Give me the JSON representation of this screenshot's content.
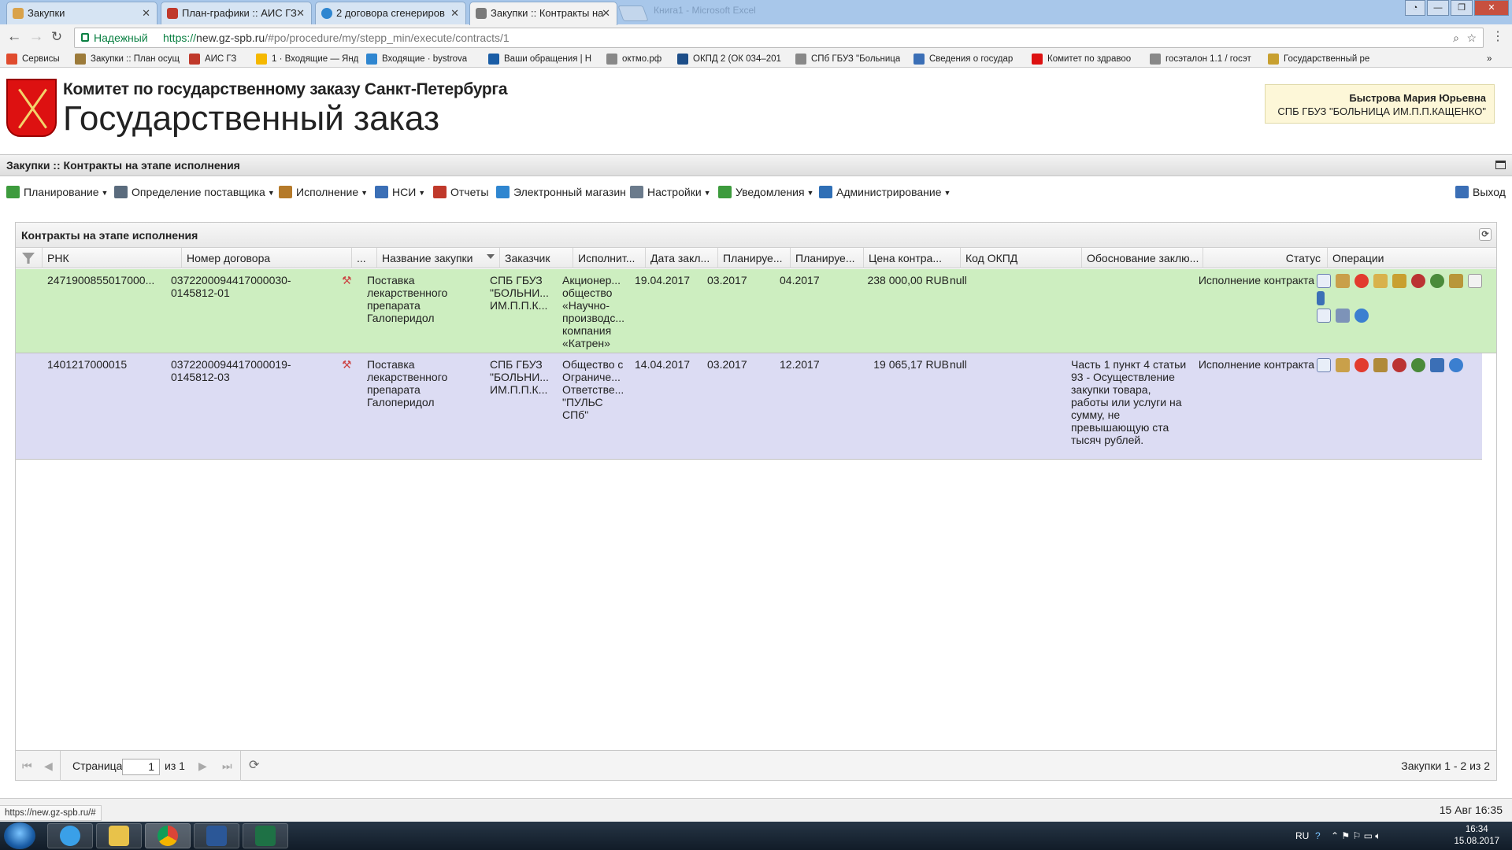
{
  "browser": {
    "tabs": [
      {
        "title": "Закупки",
        "color": "#d9a24a"
      },
      {
        "title": "План-графики :: АИС ГЗ",
        "color": "#c0392b"
      },
      {
        "title": "2 договора сгенериров",
        "color": "#2f86d0"
      },
      {
        "title": "Закупки :: Контракты на",
        "color": "#7a7a7a"
      }
    ],
    "faded_title": "Книга1 - Microsoft Excel",
    "address": {
      "secure_label": "Надежный",
      "protocol": "https://",
      "host": "new.gz-spb.ru",
      "path": "/#po/procedure/my/stepp_min/execute/contracts/1"
    },
    "bookmarks": [
      {
        "label": "Сервисы",
        "color": "#e04b2e"
      },
      {
        "label": "Закупки :: План осущ",
        "color": "#9c7b3a"
      },
      {
        "label": "АИС ГЗ",
        "color": "#c0392b"
      },
      {
        "label": "1 · Входящие — Янд",
        "color": "#f5b800"
      },
      {
        "label": "Входящие · bystrova",
        "color": "#2f86d0"
      },
      {
        "label": "Ваши обращения | Н",
        "color": "#1a5da6"
      },
      {
        "label": "октмо.рф",
        "color": "#888888"
      },
      {
        "label": "ОКПД 2 (ОК 034–201",
        "color": "#1d4e89"
      },
      {
        "label": "СПб ГБУЗ \"Больница",
        "color": "#888888"
      },
      {
        "label": "Сведения о государ",
        "color": "#3b6fb6"
      },
      {
        "label": "Комитет по здравоо",
        "color": "#d11"
      },
      {
        "label": "госэталон 1.1 / госэт",
        "color": "#888888"
      },
      {
        "label": "Государственный ре",
        "color": "#c8a030"
      }
    ],
    "bookmarks_more": "»"
  },
  "header": {
    "org": "Комитет по государственному заказу Санкт-Петербурга",
    "app": "Государственный заказ",
    "user_name": "Быстрова Мария Юрьевна",
    "user_org": "СПБ ГБУЗ \"БОЛЬНИЦА ИМ.П.П.КАЩЕНКО\""
  },
  "title": "Закупки :: Контракты на этапе исполнения",
  "menu": {
    "items": [
      {
        "label": "Планирование",
        "icon": "planning-icon",
        "dropdown": true,
        "color": "#3d9b3d"
      },
      {
        "label": "Определение поставщика",
        "icon": "gears-icon",
        "dropdown": true,
        "color": "#5a6b7d"
      },
      {
        "label": "Исполнение",
        "icon": "execution-icon",
        "dropdown": true,
        "color": "#b57a2a"
      },
      {
        "label": "НСИ",
        "icon": "book-icon",
        "dropdown": true,
        "color": "#3b6fb6"
      },
      {
        "label": "Отчеты",
        "icon": "report-icon",
        "dropdown": false,
        "color": "#c0392b"
      },
      {
        "label": "Электронный магазин",
        "icon": "cart-icon",
        "dropdown": false,
        "color": "#2f86d0"
      },
      {
        "label": "Настройки",
        "icon": "wrench-icon",
        "dropdown": true,
        "color": "#6b7b8c"
      },
      {
        "label": "Уведомления",
        "icon": "notification-icon",
        "dropdown": true,
        "color": "#3d9b3d"
      },
      {
        "label": "Администрирование",
        "icon": "admin-icon",
        "dropdown": true,
        "color": "#2f6fb6"
      }
    ],
    "logout": "Выход"
  },
  "panel": {
    "title": "Контракты на этапе исполнения",
    "columns": [
      "РНК",
      "Номер договора",
      "...",
      "Название закупки",
      "Заказчик",
      "Исполнит...",
      "Дата закл...",
      "Планируе...",
      "Планируе...",
      "Цена контра...",
      "Код ОКПД",
      "Обоснование заклю...",
      "Статус",
      "Операции"
    ],
    "rows": [
      {
        "rnk": "2471900855017000...",
        "contract_no": "0372200094417000030-0145812-01",
        "name": "Поставка лекарственного препарата Галоперидол",
        "customer": "СПБ ГБУЗ \"БОЛЬНИ... ИМ.П.П.К...",
        "supplier": "Акционер... общество «Научно-производс... компания «Катрен»",
        "date": "19.04.2017",
        "plan1": "03.2017",
        "plan2": "04.2017",
        "price": "238 000,00 RUB",
        "okpd": "null",
        "reason": "",
        "status": "Исполнение контракта",
        "bg": "#cdeec0"
      },
      {
        "rnk": "1401217000015",
        "contract_no": "0372200094417000019-0145812-03",
        "name": "Поставка лекарственного препарата Галоперидол",
        "customer": "СПБ ГБУЗ \"БОЛЬНИ... ИМ.П.П.К...",
        "supplier": "Общество с Ограниче... Ответстве... \"ПУЛЬС СПб\"",
        "date": "14.04.2017",
        "plan1": "03.2017",
        "plan2": "12.2017",
        "price": "19 065,17 RUB",
        "okpd": "null",
        "reason": "Часть 1 пункт 4 статьи 93 - Осуществление закупки товара, работы или услуги на сумму, не превышающую ста тысяч рублей.",
        "status": "Исполнение контракта",
        "bg": "#dcdcf3"
      }
    ],
    "pager": {
      "page_label": "Страница",
      "page": "1",
      "of_label": "из 1",
      "summary": "Закупки 1 - 2 из 2"
    }
  },
  "status": {
    "url": "https://new.gz-spb.ru/#",
    "datetime": "15 Авг 16:35"
  },
  "taskbar": {
    "lang": "RU",
    "time": "16:34",
    "date": "15.08.2017"
  }
}
